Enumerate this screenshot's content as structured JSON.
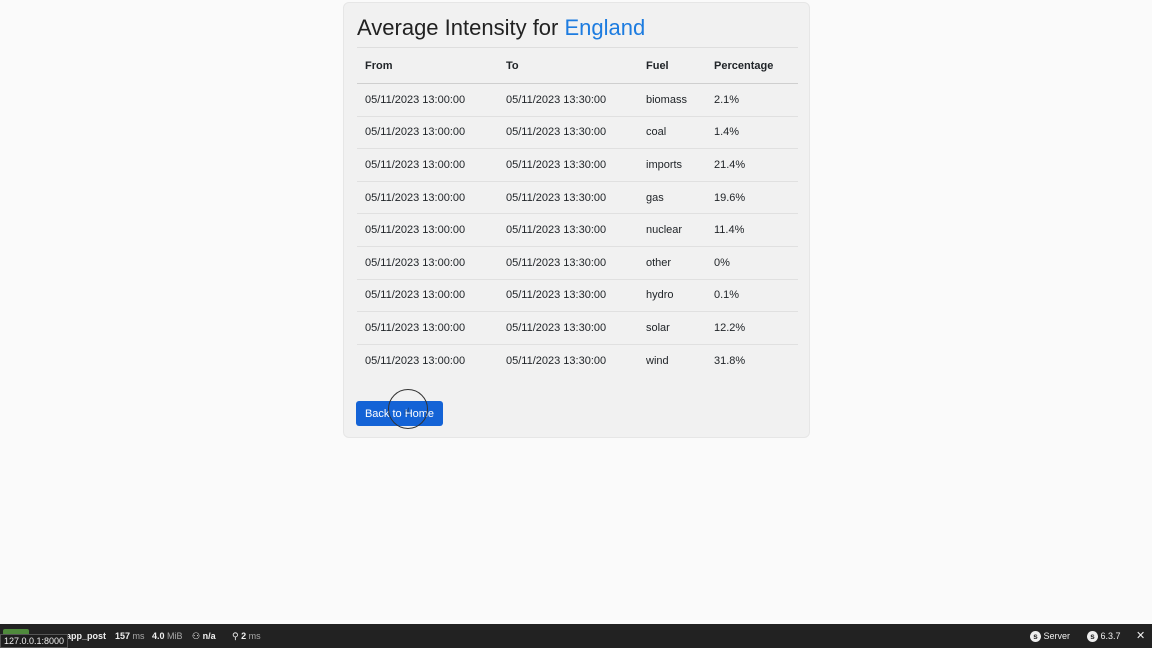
{
  "page": {
    "title_prefix": "Average Intensity for",
    "region": "England"
  },
  "table": {
    "headers": [
      "From",
      "To",
      "Fuel",
      "Percentage"
    ],
    "rows": [
      [
        "05/11/2023 13:00:00",
        "05/11/2023 13:30:00",
        "biomass",
        "2.1%"
      ],
      [
        "05/11/2023 13:00:00",
        "05/11/2023 13:30:00",
        "coal",
        "1.4%"
      ],
      [
        "05/11/2023 13:00:00",
        "05/11/2023 13:30:00",
        "imports",
        "21.4%"
      ],
      [
        "05/11/2023 13:00:00",
        "05/11/2023 13:30:00",
        "gas",
        "19.6%"
      ],
      [
        "05/11/2023 13:00:00",
        "05/11/2023 13:30:00",
        "nuclear",
        "11.4%"
      ],
      [
        "05/11/2023 13:00:00",
        "05/11/2023 13:30:00",
        "other",
        "0%"
      ],
      [
        "05/11/2023 13:00:00",
        "05/11/2023 13:30:00",
        "hydro",
        "0.1%"
      ],
      [
        "05/11/2023 13:00:00",
        "05/11/2023 13:30:00",
        "solar",
        "12.2%"
      ],
      [
        "05/11/2023 13:00:00",
        "05/11/2023 13:30:00",
        "wind",
        "31.8%"
      ]
    ]
  },
  "actions": {
    "back_label": "Back to Home"
  },
  "toolbar": {
    "route": "app_post",
    "time_value": "157",
    "time_unit": "ms",
    "memory_value": "4.0",
    "memory_unit": "MiB",
    "user": "n/a",
    "events_value": "2",
    "events_unit": "ms",
    "server_label": "Server",
    "version": "6.3.7",
    "url_tooltip": "127.0.0.1:8000",
    "status_color": "#4f8a3c"
  }
}
